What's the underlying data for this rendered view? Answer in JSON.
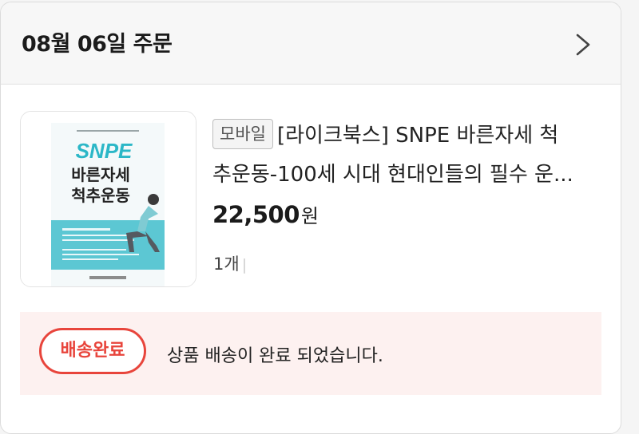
{
  "order": {
    "date_title": "08월 06일 주문",
    "chevron_icon": "chevron-right-icon"
  },
  "item": {
    "badge": "모바일",
    "title_line1": "[라이크북스] SNPE 바른자세 척",
    "title_line2": "추운동-100세 시대 현대인들의 필수 운...",
    "price": "22,500",
    "price_unit": "원",
    "quantity": "1개",
    "cover": {
      "brand": "SNPE",
      "title_line1": "바른자세",
      "title_line2": "척추운동",
      "colors": {
        "brand": "#2bb7c7",
        "band": "#5cc7d3",
        "title": "#222222"
      }
    }
  },
  "status": {
    "badge": "배송완료",
    "message": "상품 배송이 완료 되었습니다.",
    "colors": {
      "accent": "#e8453c",
      "background": "#fdf1f0"
    }
  }
}
